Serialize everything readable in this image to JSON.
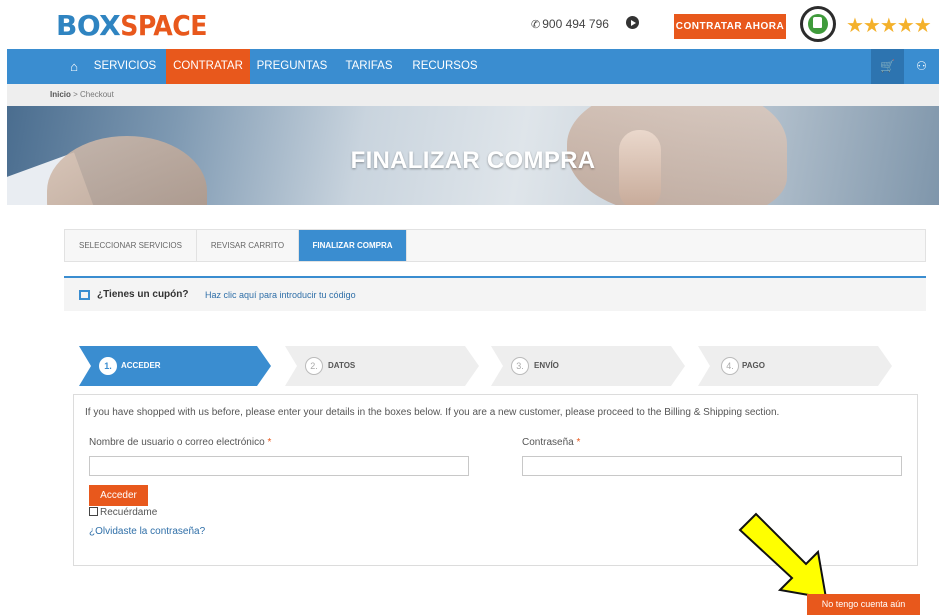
{
  "header": {
    "logo_part1": "BOX",
    "logo_part2": "SPACE",
    "phone": "900 494 796",
    "cta_label": "CONTRATAR AHORA",
    "stars": "★★★★★"
  },
  "nav": {
    "items": [
      {
        "label": "SERVICIOS"
      },
      {
        "label": "CONTRATAR"
      },
      {
        "label": "PREGUNTAS"
      },
      {
        "label": "TARIFAS"
      },
      {
        "label": "RECURSOS"
      }
    ],
    "active": "CONTRATAR"
  },
  "breadcrumb": {
    "home": "Inicio",
    "separator": " > ",
    "current": "Checkout"
  },
  "hero": {
    "title": "FINALIZAR COMPRA"
  },
  "tabs": [
    {
      "label": "SELECCIONAR SERVICIOS"
    },
    {
      "label": "REVISAR CARRITO"
    },
    {
      "label": "FINALIZAR COMPRA"
    }
  ],
  "coupon": {
    "question": "¿Tienes un cupón?",
    "link": "Haz clic aquí para introducir tu código"
  },
  "steps": [
    {
      "num": "1.",
      "label": "ACCEDER"
    },
    {
      "num": "2.",
      "label": "DATOS"
    },
    {
      "num": "3.",
      "label": "ENVÍO"
    },
    {
      "num": "4.",
      "label": "PAGO"
    }
  ],
  "login": {
    "intro": "If you have shopped with us before, please enter your details in the boxes below. If you are a new customer, please proceed to the Billing & Shipping section.",
    "username_label": "Nombre de usuario o correo electrónico",
    "password_label": "Contraseña",
    "required_mark": "*",
    "username_value": "",
    "password_value": "",
    "submit_label": "Acceder",
    "remember_label": "Recuérdame",
    "forgot_label": "¿Olvidaste la contraseña?"
  },
  "no_account_label": "No tengo cuenta aún",
  "colors": {
    "brand_blue": "#3a8dd0",
    "brand_orange": "#e8581c",
    "arrow_yellow": "#ffff00"
  }
}
